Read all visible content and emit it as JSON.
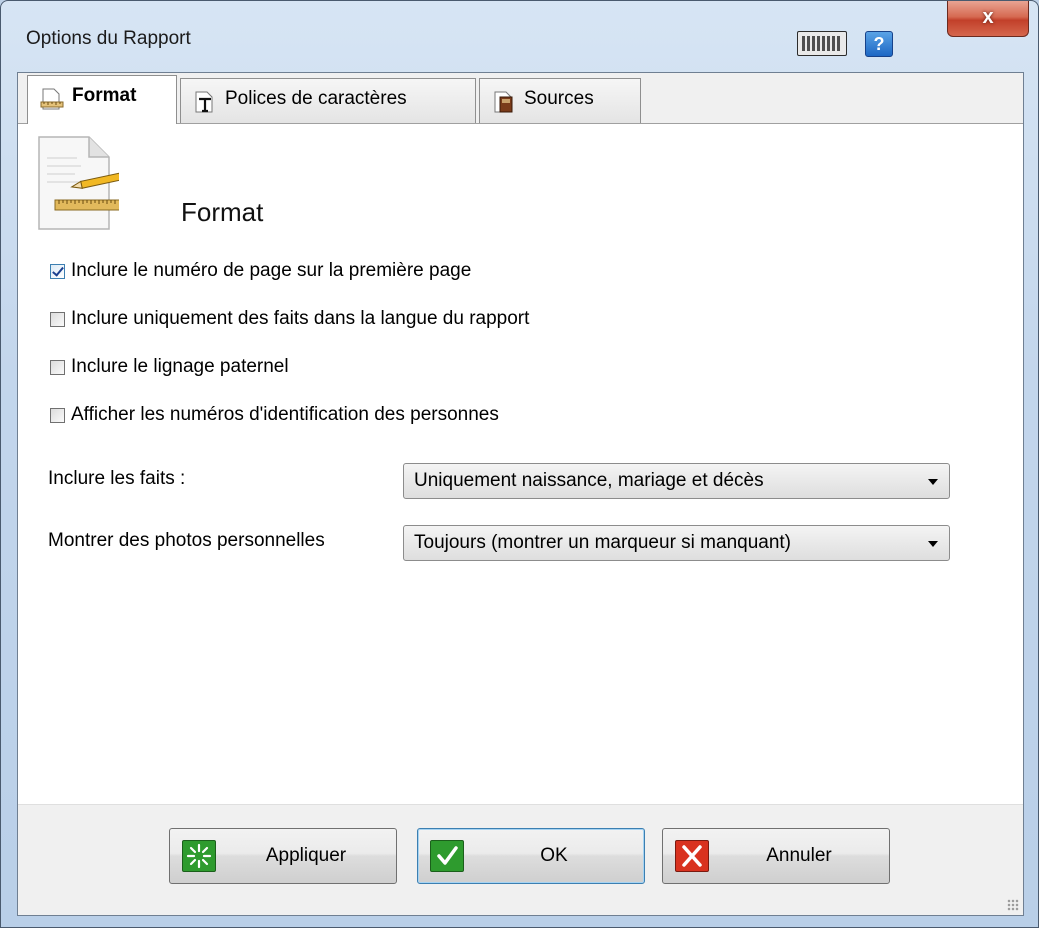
{
  "window": {
    "title": "Options du Rapport",
    "close_label": "x",
    "help_label": "?"
  },
  "tabs": [
    {
      "label": "Format",
      "active": true,
      "icon": "document-ruler-icon"
    },
    {
      "label": "Polices de caractères",
      "active": false,
      "icon": "font-icon"
    },
    {
      "label": "Sources",
      "active": false,
      "icon": "sources-icon"
    }
  ],
  "section": {
    "title": "Format",
    "icon": "document-pencil-ruler-icon"
  },
  "checkboxes": [
    {
      "label": "Inclure le numéro de page sur la première page",
      "checked": true
    },
    {
      "label": "Inclure uniquement des faits dans la langue du rapport",
      "checked": false
    },
    {
      "label": "Inclure le lignage paternel",
      "checked": false
    },
    {
      "label": "Afficher les numéros d'identification des personnes",
      "checked": false
    }
  ],
  "fields": [
    {
      "label": "Inclure les faits :",
      "value": "Uniquement naissance, mariage et décès"
    },
    {
      "label": "Montrer des photos personnelles",
      "value": "Toujours (montrer un marqueur si manquant)"
    }
  ],
  "buttons": {
    "apply": {
      "label": "Appliquer",
      "icon": "apply-sparkle-icon",
      "color": "#2e9b2e"
    },
    "ok": {
      "label": "OK",
      "icon": "checkmark-icon",
      "color": "#2e9b2e"
    },
    "cancel": {
      "label": "Annuler",
      "icon": "cross-icon",
      "color": "#d9321f"
    }
  }
}
